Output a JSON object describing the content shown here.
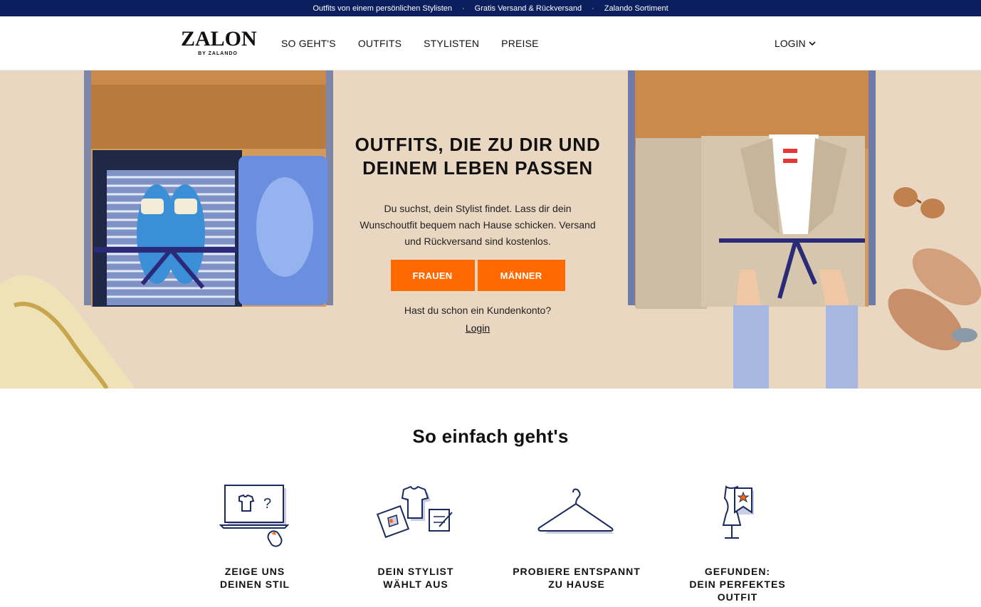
{
  "topbar": {
    "items": [
      "Outfits von einem persönlichen Stylisten",
      "Gratis Versand & Rückversand",
      "Zalando Sortiment"
    ],
    "separator": "·"
  },
  "header": {
    "logo_main": "ZALON",
    "logo_sub": "BY ZALANDO",
    "nav": [
      "SO GEHT'S",
      "OUTFITS",
      "STYLISTEN",
      "PREISE"
    ],
    "login_label": "LOGIN"
  },
  "hero": {
    "title_line1": "OUTFITS, DIE ZU DIR UND",
    "title_line2": "DEINEM LEBEN PASSEN",
    "text_line1": "Du suchst, dein Stylist findet. Lass dir dein",
    "text_line2": "Wunschoutfit bequem nach Hause schicken. Versand",
    "text_line3": "und Rückversand sind kostenlos.",
    "button_women": "FRAUEN",
    "button_men": "MÄNNER",
    "account_question": "Hast du schon ein Kundenkonto?",
    "account_login": "Login"
  },
  "how": {
    "title": "So einfach geht's",
    "steps": [
      {
        "icon": "laptop-shirt-icon",
        "line1": "ZEIGE UNS",
        "line2": "DEINEN STIL",
        "line3": ""
      },
      {
        "icon": "stylist-picks-icon",
        "line1": "DEIN STYLIST",
        "line2": "WÄHLT AUS",
        "line3": ""
      },
      {
        "icon": "hanger-icon",
        "line1": "PROBIERE ENTSPANNT",
        "line2": "ZU HAUSE",
        "line3": ""
      },
      {
        "icon": "mannequin-bookmark-icon",
        "line1": "GEFUNDEN:",
        "line2": "DEIN PERFEKTES",
        "line3": "OUTFIT"
      }
    ]
  },
  "colors": {
    "topbar": "#0b1f5f",
    "accent": "#ff6900",
    "hero_bg": "#e9d7c1",
    "icon_navy": "#1b2a5e",
    "icon_shadow": "#c9cde6"
  }
}
